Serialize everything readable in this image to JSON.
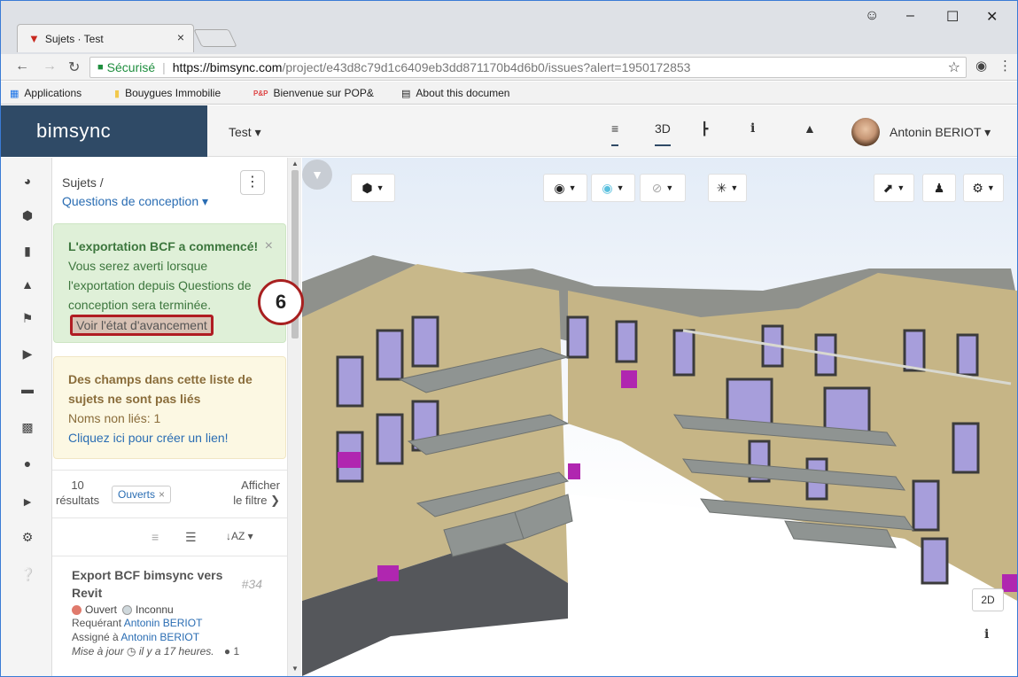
{
  "browser": {
    "tab_title": "Sujets · Test",
    "tab_close": "×",
    "secure_label": "Sécurisé",
    "url_scheme_host": "https://bimsync.com",
    "url_path": "/project/e43d8c79d1c6409eb3dd871170b4d6b0/issues?alert=1950172853",
    "bookmarks": [
      "Applications",
      "Bouygues Immobilie",
      "Bienvenue sur POP&",
      "About this documen"
    ],
    "bookmark_p2p": "P&P"
  },
  "app": {
    "logo": "bimsync",
    "project": "Test ▾",
    "nav_3d": "3D",
    "nav_info": "i",
    "user_name": "Antonin BERIOT ▾"
  },
  "panel": {
    "breadcrumb": "Sujets /",
    "category": "Questions de conception ▾",
    "kebab": "⋮",
    "export_alert": {
      "bold": "L'exportation BCF a commencé!",
      "text": " Vous serez averti lorsque l'exportation depuis Questions de conception sera terminée.",
      "button": "Voir l'état d'avancement",
      "close": "×"
    },
    "link_alert": {
      "bold": "Des champs dans cette liste de sujets ne sont pas liés",
      "unlinked": "Noms non liés: 1",
      "link": "Cliquez ici pour créer un lien!"
    },
    "results_count": "10",
    "results_label": "résultats",
    "chip_label": "Ouverts",
    "chip_remove": "×",
    "show_filter": "Afficher",
    "show_filter2": "le filtre ❯",
    "sort_label": "↓AZ ▾",
    "issue": {
      "title": "Export BCF bimsync vers Revit",
      "number": "#34",
      "status_open": "Ouvert",
      "status_unknown": "Inconnu",
      "requester_label": "Requérant",
      "requester": "Antonin BERIOT",
      "assignee_label": "Assigné à",
      "assignee": "Antonin BERIOT",
      "updated": "Mise à jour",
      "updated_when": "il y a 17 heures.",
      "comments": "1"
    }
  },
  "viewer": {
    "btn_2d": "2D",
    "info": "i"
  },
  "callout": "6",
  "colors": {
    "brand": "#2f4a66",
    "accent_red": "#e35a4b",
    "alert_success_bg": "#dff0d8",
    "alert_warning_bg": "#fcf8e3",
    "status_open": "#e07a6c",
    "status_unknown": "#cfd8dc"
  }
}
